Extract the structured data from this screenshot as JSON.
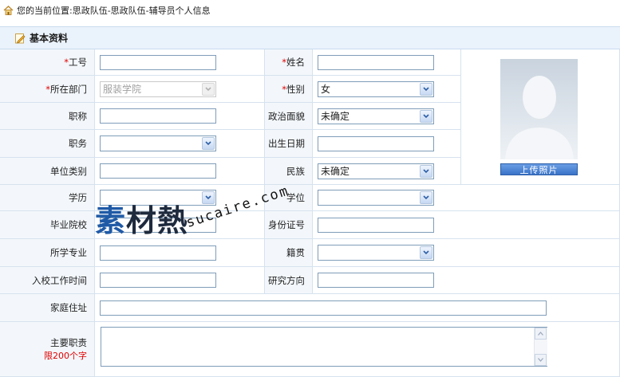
{
  "breadcrumb": {
    "text": "您的当前位置:思政队伍-思政队伍-辅导员个人信息"
  },
  "section": {
    "title": "基本资料"
  },
  "form": {
    "required_mark": "*",
    "staff_id": {
      "label": "工号",
      "value": ""
    },
    "name": {
      "label": "姓名",
      "value": ""
    },
    "department": {
      "label": "所在部门",
      "value": "服装学院"
    },
    "gender": {
      "label": "性别",
      "value": "女"
    },
    "title": {
      "label": "职称",
      "value": ""
    },
    "political": {
      "label": "政治面貌",
      "value": "未确定"
    },
    "position": {
      "label": "职务",
      "value": ""
    },
    "birth_date": {
      "label": "出生日期",
      "value": ""
    },
    "unit_type": {
      "label": "单位类别",
      "value": ""
    },
    "ethnicity": {
      "label": "民族",
      "value": "未确定"
    },
    "education": {
      "label": "学历",
      "value": ""
    },
    "degree": {
      "label": "学位",
      "value": ""
    },
    "school": {
      "label": "毕业院校",
      "value": ""
    },
    "id_number": {
      "label": "身份证号",
      "value": ""
    },
    "major": {
      "label": "所学专业",
      "value": ""
    },
    "native_place": {
      "label": "籍贯",
      "value": ""
    },
    "entry_time": {
      "label": "入校工作时间",
      "value": ""
    },
    "research": {
      "label": "研究方向",
      "value": ""
    },
    "address": {
      "label": "家庭住址",
      "value": ""
    },
    "duties": {
      "label": "主要职责",
      "limit": "限200个字",
      "value": ""
    }
  },
  "photo": {
    "upload_label": "上传照片"
  },
  "watermark": {
    "main": "素材熱",
    "sub": "sucaire.com"
  },
  "colors": {
    "label_bg": "#f3f7fb",
    "section_bg": "#eaf2fb",
    "required": "#e00000",
    "button": "#3a73c8"
  }
}
